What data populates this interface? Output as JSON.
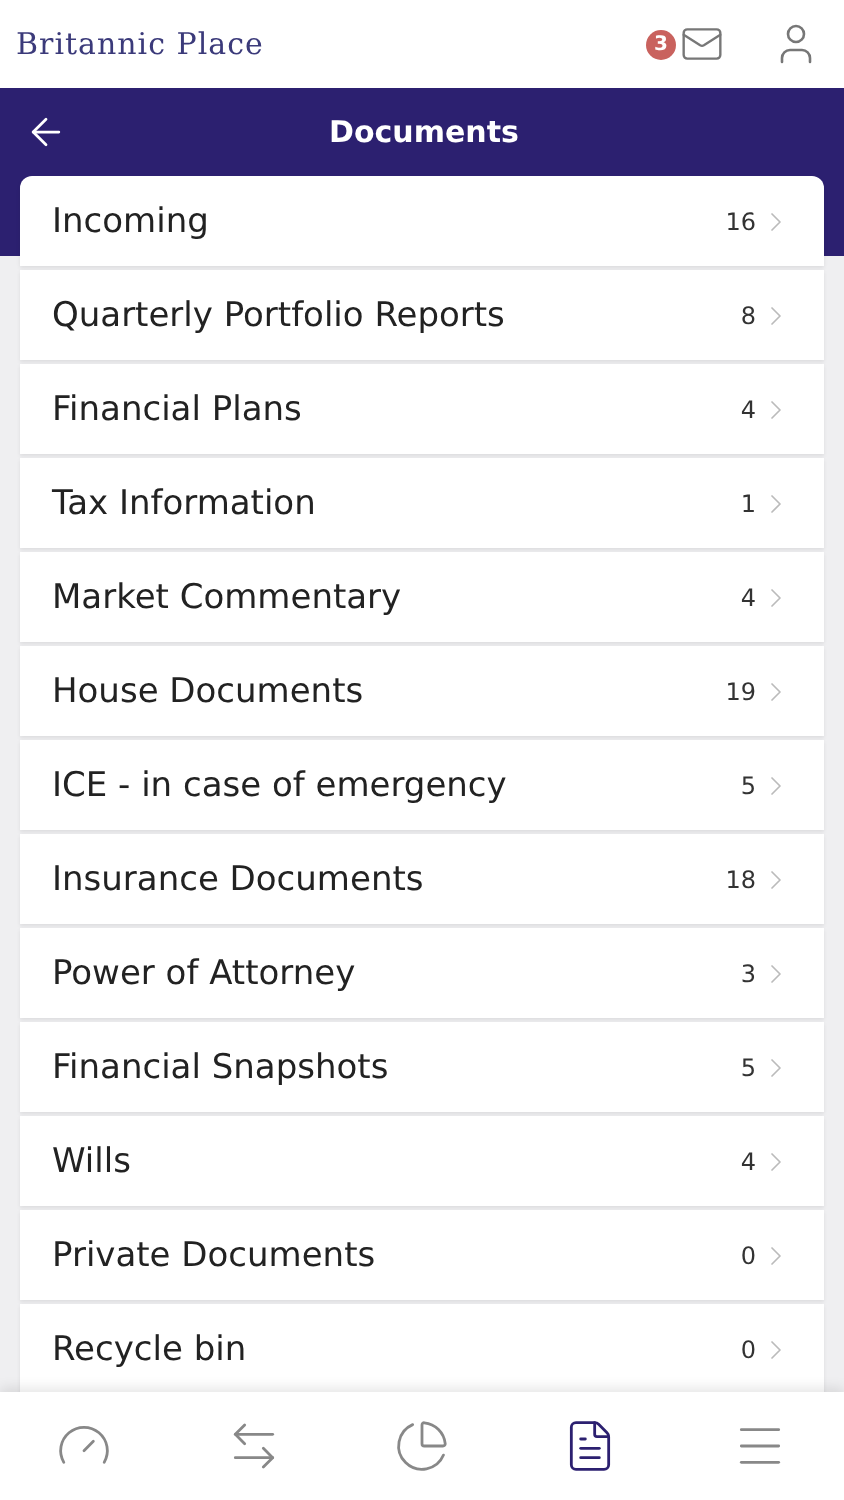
{
  "header": {
    "logo": "Britannic Place",
    "mail_badge": "3"
  },
  "title_bar": {
    "title": "Documents"
  },
  "folders": [
    {
      "name": "Incoming",
      "count": "16"
    },
    {
      "name": "Quarterly Portfolio Reports",
      "count": "8"
    },
    {
      "name": "Financial Plans",
      "count": "4"
    },
    {
      "name": "Tax Information",
      "count": "1"
    },
    {
      "name": "Market Commentary",
      "count": "4"
    },
    {
      "name": "House Documents",
      "count": "19"
    },
    {
      "name": "ICE - in case of emergency",
      "count": "5"
    },
    {
      "name": "Insurance Documents",
      "count": "18"
    },
    {
      "name": "Power of Attorney",
      "count": "3"
    },
    {
      "name": "Financial Snapshots",
      "count": "5"
    },
    {
      "name": "Wills",
      "count": "4"
    },
    {
      "name": "Private Documents",
      "count": "0"
    },
    {
      "name": "Recycle bin",
      "count": "0"
    }
  ],
  "bottom_nav": [
    {
      "kind": "dashboard",
      "selected": false
    },
    {
      "kind": "transfers",
      "selected": false
    },
    {
      "kind": "portfolio",
      "selected": false
    },
    {
      "kind": "documents",
      "selected": true
    },
    {
      "kind": "menu",
      "selected": false
    }
  ]
}
